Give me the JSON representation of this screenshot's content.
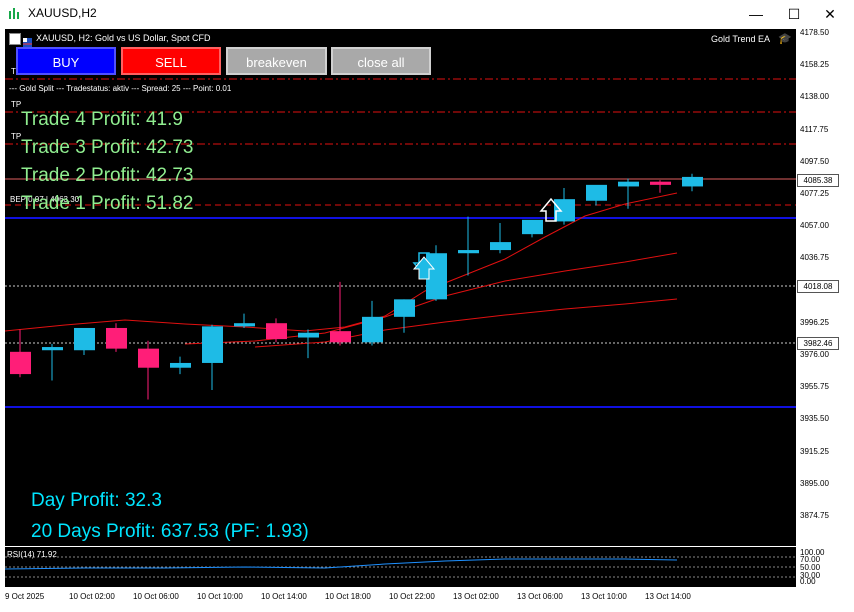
{
  "window": {
    "title": "XAUUSD,H2",
    "minimize": "—",
    "maximize": "☐",
    "close": "✕"
  },
  "header": {
    "symbol_desc": "XAUUSD, H2:  Gold vs US Dollar, Spot CFD",
    "ea_name": "Gold Trend EA",
    "status_line": "--- Gold Split --- Tradestatus: aktiv --- Spread: 25 --- Point: 0.01"
  },
  "buttons": {
    "buy": "BUY",
    "sell": "SELL",
    "breakeven": "breakeven",
    "close_all": "close all"
  },
  "labels": {
    "tp1": "TP",
    "tp2": "TP",
    "t_marker": "T",
    "bep_label": "BEP 0.07 | 4063.30"
  },
  "trades": [
    {
      "label": "Trade 4 Profit: 41.9"
    },
    {
      "label": "Trade 3 Profit: 42.73"
    },
    {
      "label": "Trade 2 Profit: 42.73"
    },
    {
      "label": "Trade 1 Profit: 51.82"
    }
  ],
  "summary": {
    "day_profit": "Day Profit: 32.3",
    "days20_profit": "20 Days Profit: 637.53 (PF: 1.93)"
  },
  "price_axis": {
    "ticks": [
      "4178.50",
      "4158.25",
      "4138.00",
      "4117.75",
      "4097.50",
      "4077.25",
      "4057.00",
      "4036.75",
      "4016.50",
      "3996.25",
      "3976.00",
      "3955.75",
      "3935.50",
      "3915.25",
      "3895.00",
      "3874.75"
    ],
    "current_price": "4085.38",
    "level_1": "4018.08",
    "level_2": "3982.46"
  },
  "time_axis": {
    "ticks": [
      "9 Oct 2025",
      "10 Oct 02:00",
      "10 Oct 06:00",
      "10 Oct 10:00",
      "10 Oct 14:00",
      "10 Oct 18:00",
      "10 Oct 22:00",
      "13 Oct 02:00",
      "13 Oct 06:00",
      "13 Oct 10:00",
      "13 Oct 14:00"
    ]
  },
  "rsi": {
    "label": "RSI(14) 71.92",
    "ticks": [
      "100.00",
      "70.00",
      "50.00",
      "30.00",
      "0.00"
    ]
  },
  "colors": {
    "bull": "#1ebbe6",
    "bear": "#ff1e78",
    "buy_btn": "#0000ff",
    "sell_btn": "#ff0000",
    "grey_btn": "#a9a9a9",
    "trade_text": "#90ee90",
    "summary_text": "#00e5ff",
    "ma_line": "#e01010",
    "blue_level": "#1010e0"
  },
  "candles": [
    {
      "open": 3978,
      "high": 3992,
      "low": 3962,
      "close": 3964
    },
    {
      "open": 3979,
      "high": 3983,
      "low": 3960,
      "close": 3981
    },
    {
      "open": 3979,
      "high": 3993,
      "low": 3976,
      "close": 3993
    },
    {
      "open": 3993,
      "high": 3996,
      "low": 3978,
      "close": 3980
    },
    {
      "open": 3980,
      "high": 3985,
      "low": 3948,
      "close": 3968
    },
    {
      "open": 3968,
      "high": 3975,
      "low": 3964,
      "close": 3971
    },
    {
      "open": 3971,
      "high": 3995,
      "low": 3954,
      "close": 3994
    },
    {
      "open": 3994,
      "high": 4002,
      "low": 3993,
      "close": 3996
    },
    {
      "open": 3996,
      "high": 3999,
      "low": 3984,
      "close": 3986
    },
    {
      "open": 3987,
      "high": 3992,
      "low": 3974,
      "close": 3990
    },
    {
      "open": 3991,
      "high": 4022,
      "low": 3982,
      "close": 3984
    },
    {
      "open": 3984,
      "high": 4010,
      "low": 3982,
      "close": 4000
    },
    {
      "open": 4000,
      "high": 4011,
      "low": 3990,
      "close": 4011
    },
    {
      "open": 4011,
      "high": 4045,
      "low": 4010,
      "close": 4040
    },
    {
      "open": 4040,
      "high": 4063,
      "low": 4026,
      "close": 4042
    },
    {
      "open": 4042,
      "high": 4059,
      "low": 4040,
      "close": 4047
    },
    {
      "open": 4052,
      "high": 4060,
      "low": 4050,
      "close": 4061
    },
    {
      "open": 4060,
      "high": 4081,
      "low": 4058,
      "close": 4074
    },
    {
      "open": 4073,
      "high": 4082,
      "low": 4070,
      "close": 4083
    },
    {
      "open": 4082,
      "high": 4087,
      "low": 4068,
      "close": 4085
    },
    {
      "open": 4085,
      "high": 4086,
      "low": 4078,
      "close": 4083
    },
    {
      "open": 4082,
      "high": 4090,
      "low": 4079,
      "close": 4088
    }
  ]
}
